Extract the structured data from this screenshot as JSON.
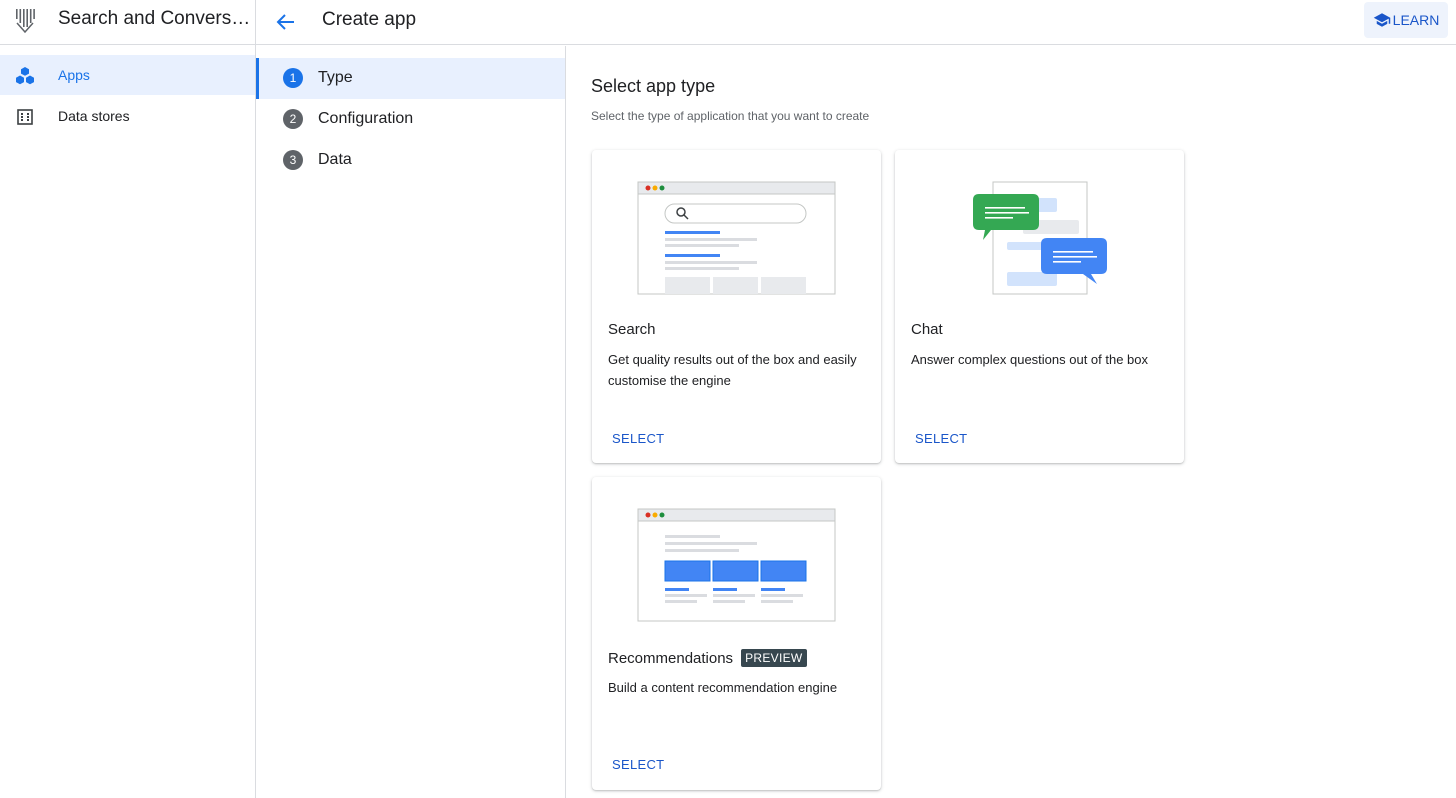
{
  "product": {
    "title": "Search and Conversat..."
  },
  "nav": {
    "items": [
      {
        "label": "Apps",
        "icon": "apps-cubes-icon",
        "active": true
      },
      {
        "label": "Data stores",
        "icon": "data-stores-grid-icon",
        "active": false
      }
    ]
  },
  "header": {
    "title": "Create app",
    "learn_label": "LEARN"
  },
  "stepper": {
    "steps": [
      {
        "number": "1",
        "label": "Type",
        "active": true
      },
      {
        "number": "2",
        "label": "Configuration",
        "active": false
      },
      {
        "number": "3",
        "label": "Data",
        "active": false
      }
    ]
  },
  "main": {
    "title": "Select app type",
    "subtitle": "Select the type of application that you want to create",
    "cards": [
      {
        "title": "Search",
        "description": "Get quality results out of the box and easily customise the engine",
        "select_label": "SELECT"
      },
      {
        "title": "Chat",
        "description": "Answer complex questions out of the box",
        "select_label": "SELECT"
      },
      {
        "title": "Recommendations",
        "badge": "PREVIEW",
        "description": "Build a content recommendation engine",
        "select_label": "SELECT"
      }
    ]
  },
  "colors": {
    "accent": "#1a73e8",
    "link": "#1a56c9",
    "chat_green": "#34a853",
    "chat_blue": "#4285f4",
    "badge": "#37474f"
  }
}
